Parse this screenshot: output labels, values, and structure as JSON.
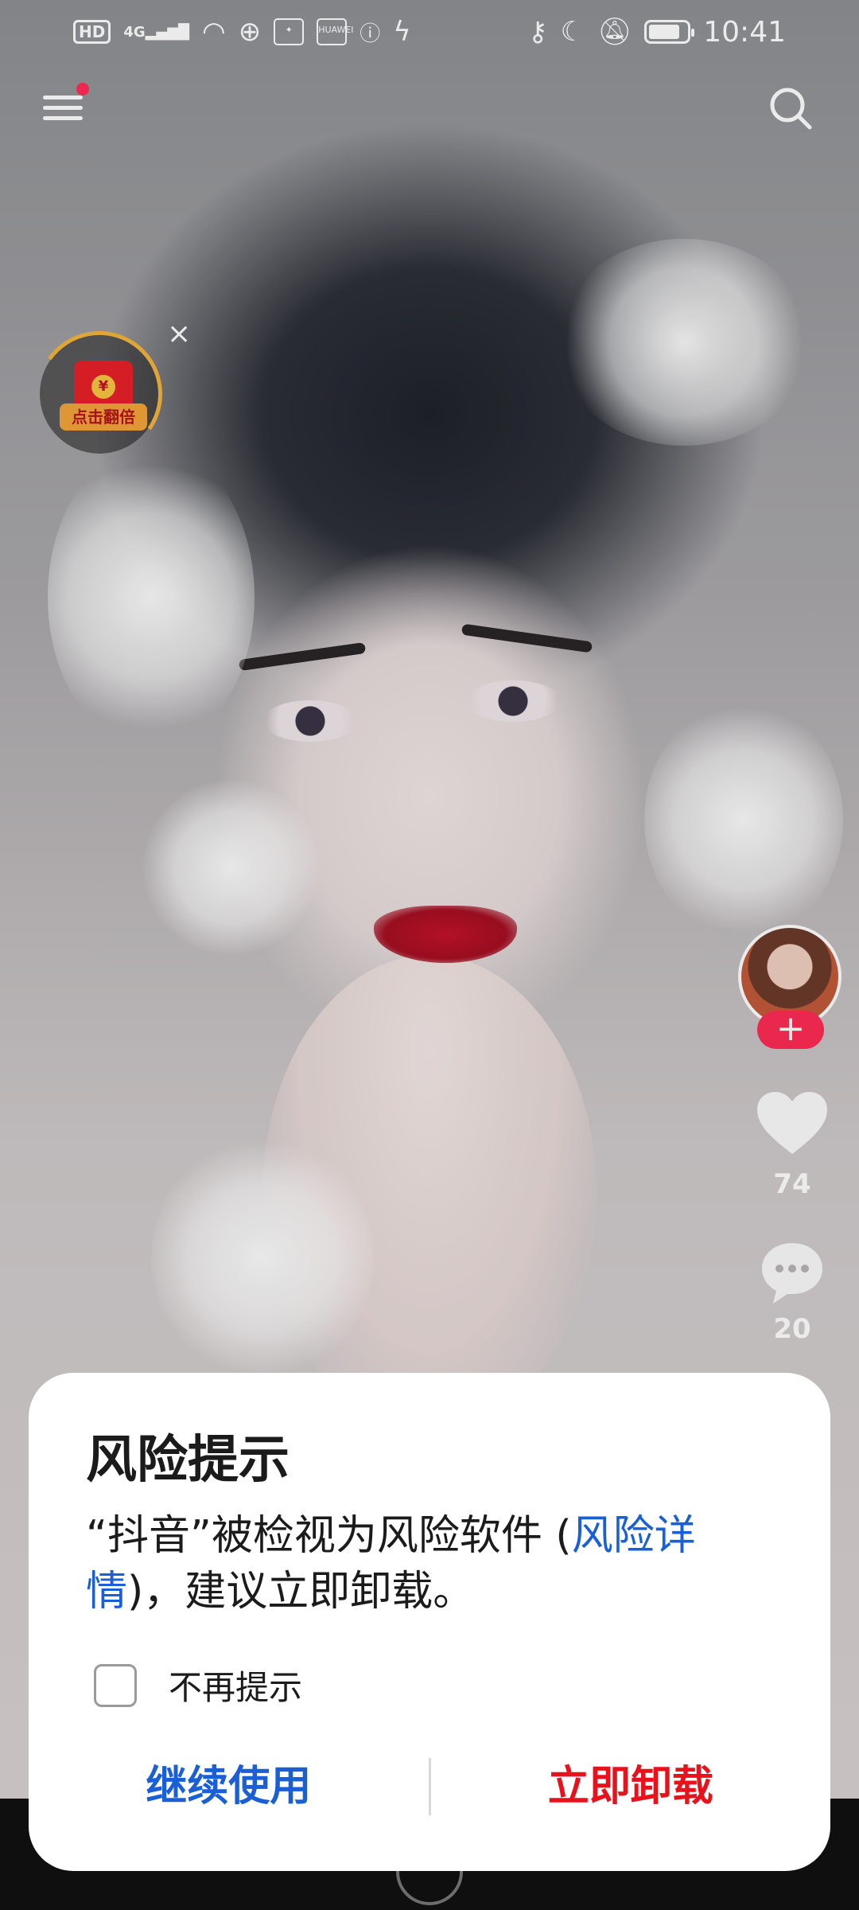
{
  "status_bar": {
    "hd": "HD",
    "network": "4G",
    "time": "10:41",
    "left_icons": [
      "hd-icon",
      "signal-icon",
      "wifi-icon",
      "globe-icon",
      "app-icon",
      "huawei-icon",
      "info-icon",
      "charging-icon"
    ],
    "right_icons": [
      "key-icon",
      "moon-icon",
      "bell-off-icon",
      "battery-icon"
    ],
    "mini_app_label": "HUAWEI"
  },
  "top_bar": {
    "menu_icon": "menu-icon",
    "search_icon": "search-icon"
  },
  "red_packet": {
    "coin": "¥",
    "label": "点击翻倍",
    "close": "×"
  },
  "side_actions": {
    "follow": "+",
    "likes": "74",
    "comments": "20"
  },
  "dialog": {
    "title": "风险提示",
    "message_prefix": "“抖音”被检视为风险软件 (",
    "message_link": "风险详情",
    "message_suffix": ")，建议立即卸载。",
    "dont_show_label": "不再提示",
    "continue_label": "继续使用",
    "uninstall_label": "立即卸载"
  },
  "colors": {
    "link_blue": "#1a5fd6",
    "danger_red": "#e8121c",
    "follow_red": "#fe2c55",
    "packet_red": "#e8202a",
    "packet_gold": "#f2a43a"
  }
}
